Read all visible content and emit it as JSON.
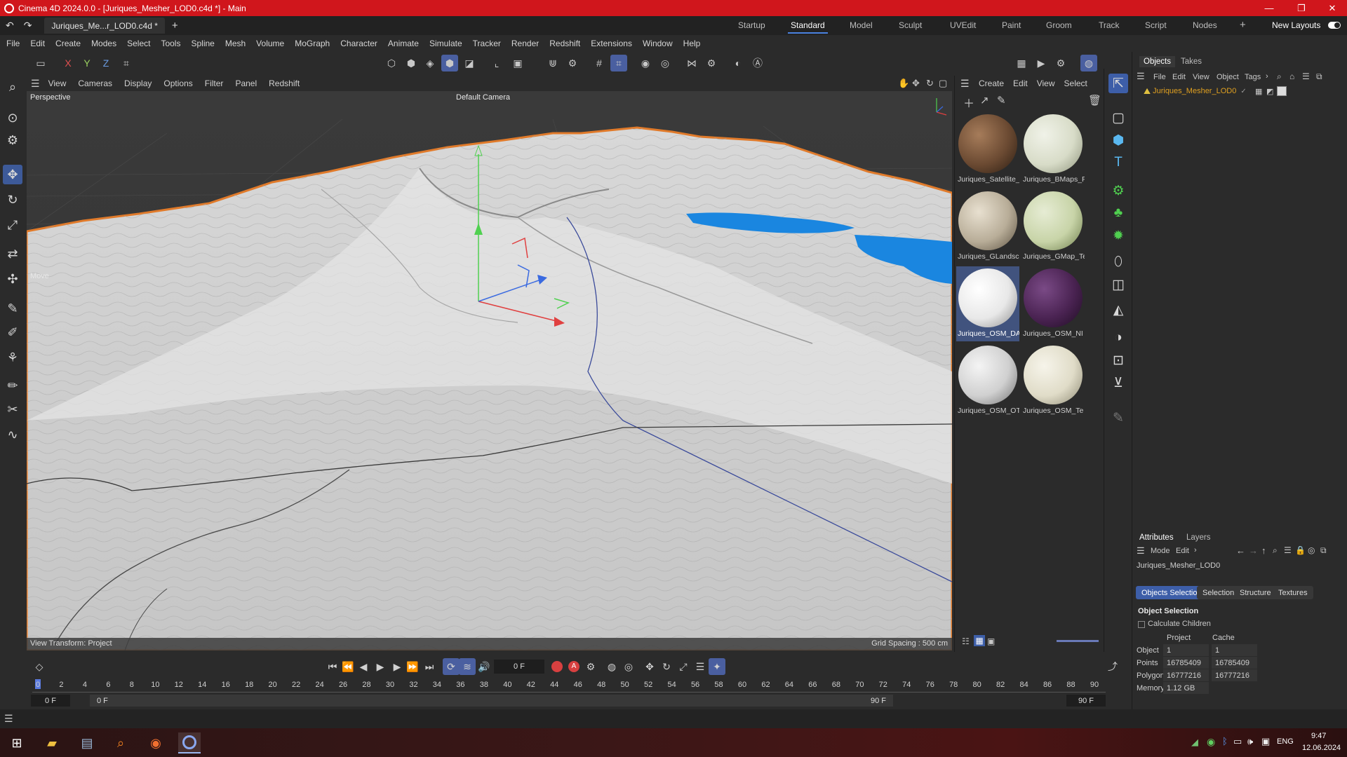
{
  "window": {
    "title": "Cinema 4D 2024.0.0 - [Juriques_Mesher_LOD0.c4d *] - Main",
    "minimize": "—",
    "maximize": "❐",
    "close": "✕"
  },
  "doc_tab": {
    "label": "Juriques_Me...r_LOD0.c4d *",
    "add": "+"
  },
  "layouts": {
    "tabs": [
      "Startup",
      "Standard",
      "Model",
      "Sculpt",
      "UVEdit",
      "Paint",
      "Groom",
      "Track",
      "Script",
      "Nodes"
    ],
    "active": "Standard",
    "add": "+",
    "new_layouts": "New Layouts"
  },
  "menu": [
    "File",
    "Edit",
    "Create",
    "Modes",
    "Select",
    "Tools",
    "Spline",
    "Mesh",
    "Volume",
    "MoGraph",
    "Character",
    "Animate",
    "Simulate",
    "Tracker",
    "Render",
    "Redshift",
    "Extensions",
    "Window",
    "Help"
  ],
  "axis_toggles": [
    "X",
    "Y",
    "Z"
  ],
  "viewport": {
    "menu": [
      "View",
      "Cameras",
      "Display",
      "Options",
      "Filter",
      "Panel",
      "Redshift"
    ],
    "projection": "Perspective",
    "camera": "Default Camera",
    "tool_label": "Move",
    "view_transform": "View Transform: Project",
    "grid_spacing": "Grid Spacing : 500 cm"
  },
  "material_panel": {
    "menu": [
      "Create",
      "Edit",
      "View",
      "Select"
    ],
    "materials": [
      {
        "label": "Juriques_Satellite_",
        "color": "#6b4a32"
      },
      {
        "label": "Juriques_BMaps_F",
        "color": "#d8dcc8"
      },
      {
        "label": "Juriques_GLandsc",
        "color": "#b8ad98"
      },
      {
        "label": "Juriques_GMap_Te",
        "color": "#c8d4a8"
      },
      {
        "label": "Juriques_OSM_DA",
        "color": "#e8e8e8"
      },
      {
        "label": "Juriques_OSM_NI",
        "color": "#4a2352"
      },
      {
        "label": "Juriques_OSM_OT",
        "color": "#d0d0d0"
      },
      {
        "label": "Juriques_OSM_Te",
        "color": "#e0dcc8"
      }
    ]
  },
  "objects_panel": {
    "tabs": [
      "Objects",
      "Takes"
    ],
    "menu": [
      "File",
      "Edit",
      "View",
      "Object",
      "Tags"
    ],
    "items": [
      {
        "name": "Juriques_Mesher_LOD0"
      }
    ]
  },
  "attributes": {
    "tabs": [
      "Attributes",
      "Layers"
    ],
    "menu": [
      "Mode",
      "Edit"
    ],
    "object_name": "Juriques_Mesher_LOD0",
    "subtabs": [
      "Objects Selection",
      "Selection",
      "Structure",
      "Textures"
    ],
    "section_title": "Object Selection",
    "calc_children": "Calculate Children",
    "col_project": "Project",
    "col_cache": "Cache",
    "rows": [
      {
        "label": "Object",
        "project": "1",
        "cache": "1"
      },
      {
        "label": "Points",
        "project": "16785409",
        "cache": "16785409"
      },
      {
        "label": "Polygons",
        "project": "16777216",
        "cache": "16777216"
      },
      {
        "label": "Memory",
        "project": "1.12 GB",
        "cache": ""
      }
    ]
  },
  "timeline": {
    "current_frame": "0 F",
    "ticks": [
      "0",
      "2",
      "4",
      "6",
      "8",
      "10",
      "12",
      "14",
      "16",
      "18",
      "20",
      "22",
      "24",
      "26",
      "28",
      "30",
      "32",
      "34",
      "36",
      "38",
      "40",
      "42",
      "44",
      "46",
      "48",
      "50",
      "52",
      "54",
      "56",
      "58",
      "60",
      "62",
      "64",
      "66",
      "68",
      "70",
      "72",
      "74",
      "76",
      "78",
      "80",
      "82",
      "84",
      "86",
      "88",
      "90"
    ],
    "start": "0 F",
    "start2": "0 F",
    "end": "90 F",
    "end2": "90 F"
  },
  "taskbar": {
    "language": "ENG",
    "time": "9:47",
    "date": "12.06.2024"
  },
  "colors": {
    "accent": "#4a82e0",
    "title_red": "#d0161c",
    "water": "#1a86e0",
    "ridge": "#e07a2a",
    "selection": "#3d5ea8"
  }
}
